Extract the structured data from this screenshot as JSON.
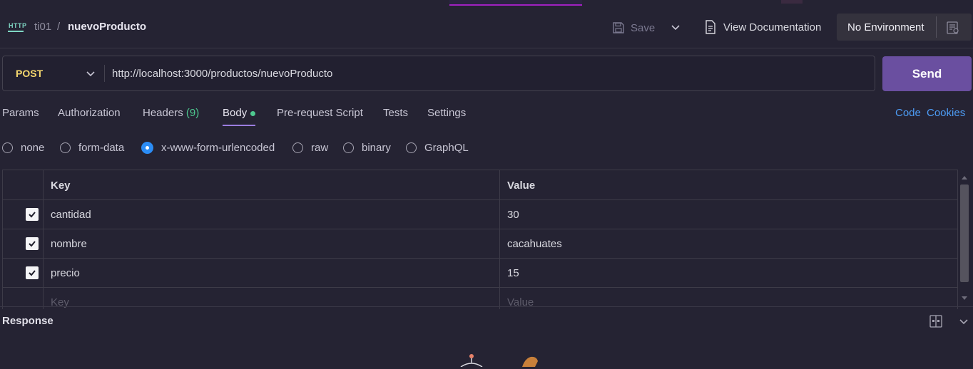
{
  "header": {
    "protocol_badge": "HTTP",
    "breadcrumb_parent": "ti01",
    "breadcrumb_separator": "/",
    "request_name": "nuevoProducto",
    "save_label": "Save",
    "view_documentation_label": "View Documentation",
    "environment_label": "No Environment"
  },
  "request": {
    "method": "POST",
    "url": "http://localhost:3000/productos/nuevoProducto",
    "send_label": "Send"
  },
  "tabs": {
    "params": "Params",
    "authorization": "Authorization",
    "headers": "Headers",
    "headers_count": "(9)",
    "body": "Body",
    "prerequest": "Pre-request Script",
    "tests": "Tests",
    "settings": "Settings",
    "active": "Body"
  },
  "links": {
    "code": "Code",
    "cookies": "Cookies"
  },
  "body_types": {
    "none": "none",
    "form_data": "form-data",
    "urlencoded": "x-www-form-urlencoded",
    "raw": "raw",
    "binary": "binary",
    "graphql": "GraphQL",
    "selected": "x-www-form-urlencoded"
  },
  "table": {
    "header_key": "Key",
    "header_value": "Value",
    "rows": [
      {
        "key": "cantidad",
        "value": "30",
        "checked": true
      },
      {
        "key": "nombre",
        "value": "cacahuates",
        "checked": true
      },
      {
        "key": "precio",
        "value": "15",
        "checked": true
      }
    ],
    "placeholder_key": "Key",
    "placeholder_value": "Value"
  },
  "response": {
    "title": "Response"
  },
  "colors": {
    "accent": "#6a4fa0",
    "method": "#f5d76e",
    "link": "#4d9cf5",
    "radio_selected": "#2b8cf5",
    "count_green": "#4ec990"
  }
}
